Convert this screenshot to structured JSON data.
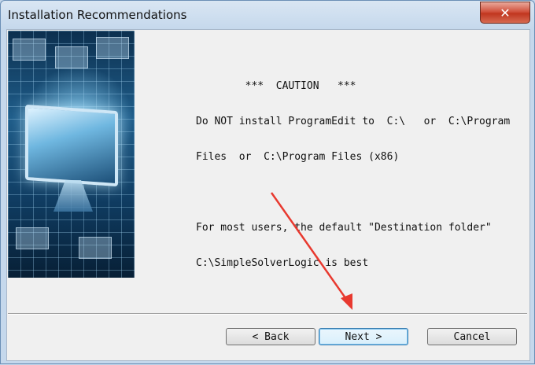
{
  "window": {
    "title": "Installation Recommendations",
    "close_label": "✕"
  },
  "message": {
    "line1": "        ***  CAUTION   ***",
    "line2": "Do NOT install ProgramEdit to  C:\\   or  C:\\Program",
    "line3": "Files  or  C:\\Program Files (x86)",
    "line4": "",
    "line5": "For most users, the default \"Destination folder\"",
    "line6": "C:\\SimpleSolverLogic is best"
  },
  "buttons": {
    "back": "< Back",
    "next": "Next >",
    "cancel": "Cancel"
  },
  "icons": {
    "close": "close-icon",
    "annotation": "red-arrow"
  },
  "colors": {
    "annotation_arrow": "#e8392f",
    "close_button": "#c9412a"
  }
}
